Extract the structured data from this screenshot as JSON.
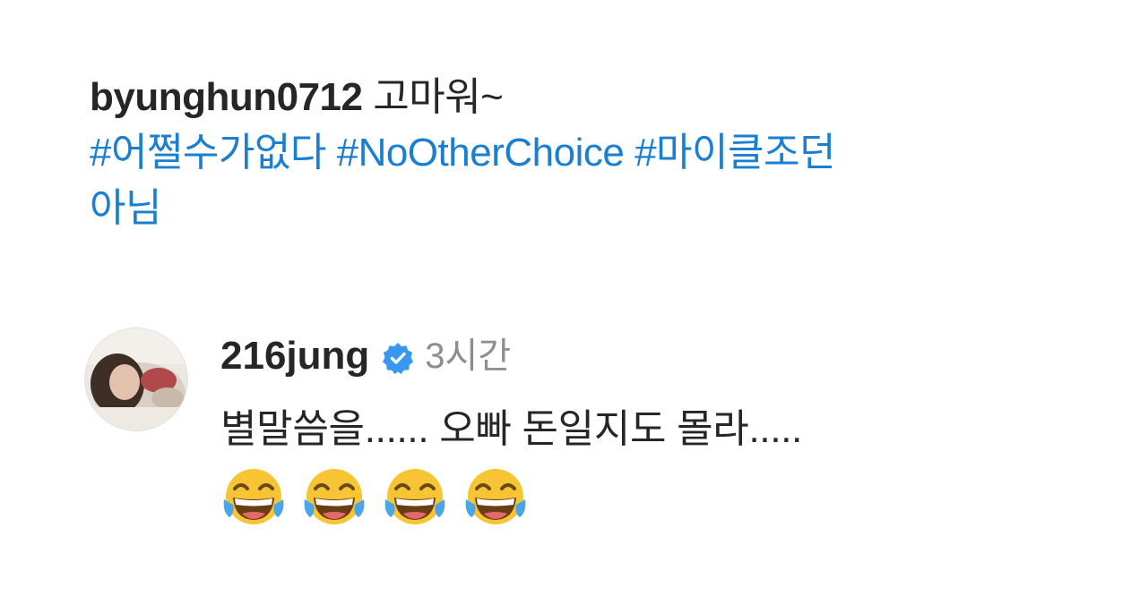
{
  "post_caption": {
    "username": "byunghun0712",
    "text": "고마워~",
    "hashtags": [
      "#어쩔수가없다",
      "#NoOtherChoice",
      "#마이클조던"
    ],
    "trailing_text": "아님"
  },
  "comment": {
    "username": "216jung",
    "verified_icon": "verified-badge-icon",
    "time": "3시간",
    "text": "별말씀을...... 오빠 돈일지도 몰라.....",
    "emojis": [
      "face-with-tears-of-joy",
      "face-with-tears-of-joy",
      "face-with-tears-of-joy",
      "face-with-tears-of-joy"
    ]
  },
  "colors": {
    "hashtag": "#1a7fd0",
    "text": "#262626",
    "muted": "#8e8e8e",
    "verified": "#3897f0"
  }
}
